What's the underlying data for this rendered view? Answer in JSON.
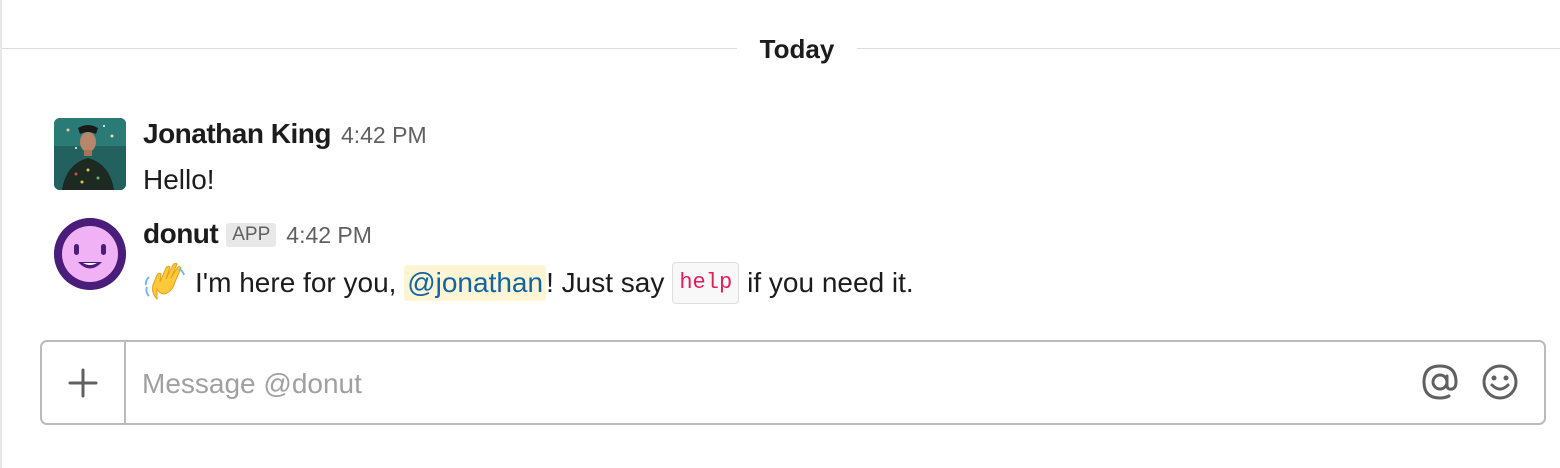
{
  "divider": {
    "label": "Today"
  },
  "messages": [
    {
      "author": "Jonathan King",
      "time": "4:42 PM",
      "text": "Hello!",
      "avatar": "user-photo"
    },
    {
      "author": "donut",
      "badge": "APP",
      "time": "4:42 PM",
      "emoji": "waving-hand-icon",
      "text_before": "I'm here for you, ",
      "mention": "@jonathan",
      "text_middle": "! Just say",
      "code": "help",
      "text_after": "if you need it.",
      "avatar": "donut-bot-icon"
    }
  ],
  "composer": {
    "placeholder": "Message @donut",
    "plus_icon": "plus-icon",
    "at_icon": "at-sign-icon",
    "emoji_icon": "smiley-icon"
  },
  "colors": {
    "mention_bg": "#fdf5d4",
    "mention_text": "#1264a3",
    "code_text": "#e01e5a",
    "donut_avatar_ring": "#4a1d7a",
    "donut_avatar_face": "#f0b2f5"
  }
}
